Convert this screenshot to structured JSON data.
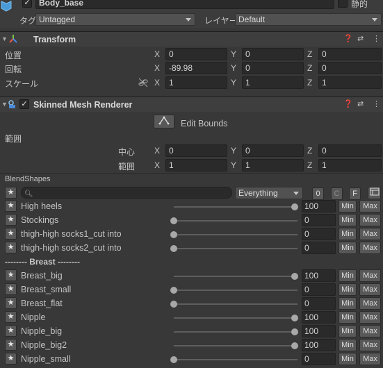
{
  "object": {
    "name": "Body_base",
    "static_label": "静的",
    "tag_label": "タグ",
    "tag_value": "Untagged",
    "layer_label": "レイヤー",
    "layer_value": "Default"
  },
  "transform": {
    "title": "Transform",
    "rows": [
      {
        "label": "位置",
        "x": "0",
        "y": "0",
        "z": "0"
      },
      {
        "label": "回転",
        "x": "-89.98",
        "y": "0",
        "z": "0"
      },
      {
        "label": "スケール",
        "x": "1",
        "y": "1",
        "z": "1"
      }
    ],
    "axis": {
      "x": "X",
      "y": "Y",
      "z": "Z"
    }
  },
  "smr": {
    "title": "Skinned Mesh Renderer",
    "edit_bounds": "Edit Bounds",
    "bounds_label": "範囲",
    "center_label": "中心",
    "extent_label": "範囲",
    "center": {
      "x": "0",
      "y": "0",
      "z": "0"
    },
    "extent": {
      "x": "1",
      "y": "1",
      "z": "1"
    }
  },
  "blendshapes": {
    "title": "BlendShapes",
    "search_placeholder": "",
    "filter_value": "Everything",
    "count": "0",
    "c_label": "C",
    "f_label": "F",
    "min_label": "Min",
    "max_label": "Max",
    "items": [
      {
        "name": "High heels",
        "value": "100",
        "level": 1
      },
      {
        "name": "Stockings",
        "value": "0",
        "level": 0
      },
      {
        "name": "thigh-high socks1_cut into",
        "value": "0",
        "level": 0
      },
      {
        "name": "thigh-high socks2_cut into",
        "value": "0",
        "level": 0
      },
      {
        "name": "-------- Breast --------",
        "separator": true
      },
      {
        "name": "Breast_big",
        "value": "100",
        "level": 1
      },
      {
        "name": "Breast_small",
        "value": "0",
        "level": 0
      },
      {
        "name": "Breast_flat",
        "value": "0",
        "level": 0
      },
      {
        "name": "Nipple",
        "value": "100",
        "level": 1
      },
      {
        "name": "Nipple_big",
        "value": "100",
        "level": 1
      },
      {
        "name": "Nipple_big2",
        "value": "100",
        "level": 1
      },
      {
        "name": "Nipple_small",
        "value": "0",
        "level": 0
      }
    ]
  },
  "colors": {
    "background": "#383838",
    "field": "#2a2a2a",
    "button": "#585858",
    "text": "#c4c4c4"
  }
}
